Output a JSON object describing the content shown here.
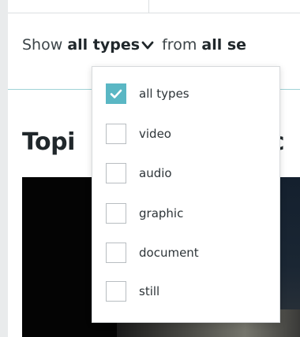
{
  "filter": {
    "show_label": "Show",
    "type_value": "all types",
    "from_label": "from",
    "source_value": "all se"
  },
  "heading": {
    "left": "Topi",
    "right": "nc"
  },
  "type_menu": {
    "options": [
      {
        "label": "all types",
        "checked": true
      },
      {
        "label": "video",
        "checked": false
      },
      {
        "label": "audio",
        "checked": false
      },
      {
        "label": "graphic",
        "checked": false
      },
      {
        "label": "document",
        "checked": false
      },
      {
        "label": "still",
        "checked": false
      }
    ]
  },
  "colors": {
    "accent": "#5ab7c4",
    "divider": "#9fd2d6",
    "text": "#20272b"
  },
  "icons": {
    "dropdown_chevron": "chevron-down-icon",
    "checkmark": "check-icon"
  }
}
